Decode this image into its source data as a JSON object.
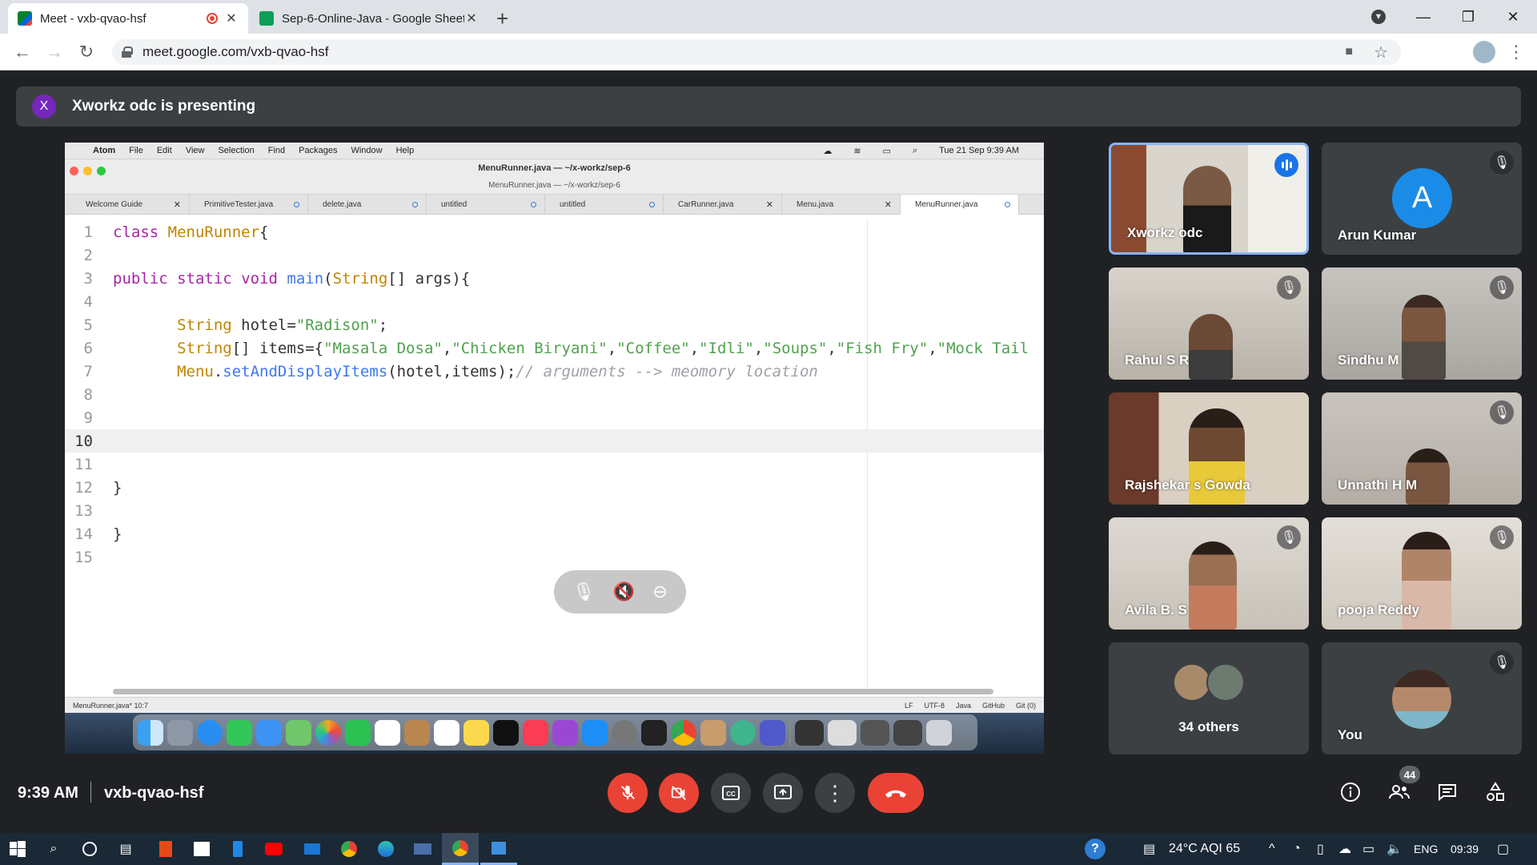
{
  "browser": {
    "tabs": [
      {
        "title": "Meet - vxb-qvao-hsf",
        "active": true,
        "recording": true
      },
      {
        "title": "Sep-6-Online-Java - Google Sheets",
        "active": false
      }
    ],
    "url": "meet.google.com/vxb-qvao-hsf"
  },
  "presenting": {
    "avatar_letter": "X",
    "text": "Xworkz odc is presenting"
  },
  "mac": {
    "menu": [
      "Atom",
      "File",
      "Edit",
      "View",
      "Selection",
      "Find",
      "Packages",
      "Window",
      "Help"
    ],
    "clock": "Tue 21 Sep  9:39 AM",
    "window_title": "MenuRunner.java — ~/x-workz/sep-6",
    "window_subtitle": "MenuRunner.java — ~/x-workz/sep-6",
    "editor_tabs": [
      "Welcome Guide",
      "PrimitiveTester.java",
      "delete.java",
      "untitled",
      "untitled",
      "CarRunner.java",
      "Menu.java",
      "MenuRunner.java"
    ],
    "status_left": "MenuRunner.java*  10:7",
    "status_right": [
      "LF",
      "UTF-8",
      "Java",
      "GitHub",
      "Git (0)"
    ]
  },
  "code": {
    "line_numbers": [
      "1",
      "2",
      "3",
      "4",
      "5",
      "6",
      "7",
      "8",
      "9",
      "10",
      "11",
      "12",
      "13",
      "14",
      "15"
    ],
    "current_line": 10
  },
  "participants": [
    {
      "name": "Xworkz odc",
      "speaking": true
    },
    {
      "name": "Arun Kumar",
      "avatar_letter": "A",
      "avatar_color": "#1a8ce8"
    },
    {
      "name": "Rahul S R"
    },
    {
      "name": "Sindhu M"
    },
    {
      "name": "Rajshekar s Gowda"
    },
    {
      "name": "Unnathi H M"
    },
    {
      "name": "Avila B. S"
    },
    {
      "name": "pooja Reddy"
    },
    {
      "name": "34 others"
    },
    {
      "name": "You"
    }
  ],
  "meeting": {
    "time": "9:39 AM",
    "code": "vxb-qvao-hsf",
    "participant_count": "44"
  },
  "taskbar": {
    "weather": "24°C  AQI 65",
    "lang": "ENG",
    "time": "09:39"
  },
  "colors": {
    "mic_off": "#ea4335",
    "end_call": "#ea4335",
    "meet_bg": "#202124",
    "tile_bg": "#3c4043",
    "speaking": "#1a73e8"
  }
}
